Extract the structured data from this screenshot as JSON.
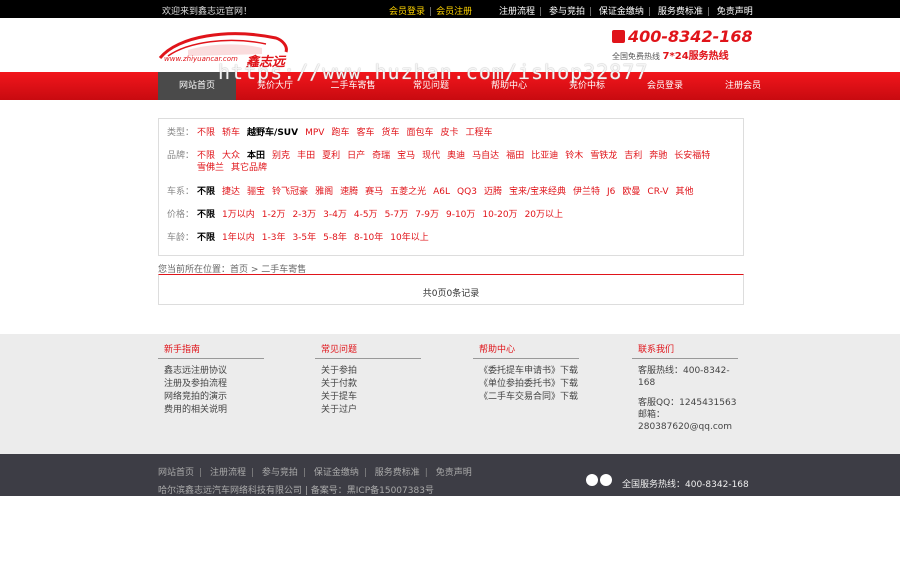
{
  "topbar": {
    "welcome": "欢迎来到鑫志远官网！",
    "member_login": "会员登录",
    "member_register": "会员注册",
    "links": [
      "注册流程",
      "参与竞拍",
      "保证金缴纳",
      "服务费标准",
      "免责声明"
    ]
  },
  "header": {
    "logo_text": "鑫志远",
    "logo_url": "www.zhiyuancar.com",
    "phone": "400-8342-168",
    "hotline_label": "全国免费热线",
    "hotline_hours": "7*24服务热线"
  },
  "watermark": "https://www.huzhan.com/ishop32877",
  "nav": [
    "网站首页",
    "竞价大厅",
    "二手车寄售",
    "常见问题",
    "帮助中心",
    "竞价中标",
    "会员登录",
    "注册会员"
  ],
  "filters": [
    {
      "label": "类型：",
      "options": [
        "不限",
        "轿车",
        "越野车/SUV",
        "MPV",
        "跑车",
        "客车",
        "货车",
        "面包车",
        "皮卡",
        "工程车"
      ],
      "selected": 2
    },
    {
      "label": "品牌：",
      "options": [
        "不限",
        "大众",
        "本田",
        "别克",
        "丰田",
        "夏利",
        "日产",
        "奇瑞",
        "宝马",
        "现代",
        "奥迪",
        "马自达",
        "福田",
        "比亚迪",
        "铃木",
        "雪铁龙",
        "吉利",
        "奔驰",
        "长安福特",
        "雪佛兰",
        "其它品牌"
      ],
      "selected": 2
    },
    {
      "label": "车系：",
      "options": [
        "不限",
        "捷达",
        "骊宝",
        "铃飞冠豪",
        "雅阁",
        "速腾",
        "赛马",
        "五菱之光",
        "A6L",
        "QQ3",
        "迈腾",
        "宝来/宝来经典",
        "伊兰特",
        "J6",
        "欧曼",
        "CR-V",
        "其他"
      ],
      "selected": 0
    },
    {
      "label": "价格：",
      "options": [
        "不限",
        "1万以内",
        "1-2万",
        "2-3万",
        "3-4万",
        "4-5万",
        "5-7万",
        "7-9万",
        "9-10万",
        "10-20万",
        "20万以上"
      ],
      "selected": 0
    },
    {
      "label": "车龄：",
      "options": [
        "不限",
        "1年以内",
        "1-3年",
        "3-5年",
        "5-8年",
        "8-10年",
        "10年以上"
      ],
      "selected": 0
    }
  ],
  "breadcrumb": "您当前所在位置：首页 > 二手车寄售",
  "result_text": "共0页0条记录",
  "footer_help": [
    {
      "title": "新手指南",
      "items": [
        "鑫志远注册协议",
        "注册及参拍流程",
        "网络竞拍的演示",
        "费用的相关说明"
      ]
    },
    {
      "title": "常见问题",
      "items": [
        "关于参拍",
        "关于付款",
        "关于提车",
        "关于过户"
      ]
    },
    {
      "title": "帮助中心",
      "items": [
        "《委托提车申请书》下载",
        "《单位参拍委托书》下载",
        "《二手车交易合同》下载"
      ]
    },
    {
      "title": "联系我们",
      "items": [
        "客服热线：400-8342-168",
        "客服QQ：1245431563",
        "邮箱：280387620@qq.com"
      ]
    }
  ],
  "footer_links": [
    "网站首页",
    "注册流程",
    "参与竞拍",
    "保证金缴纳",
    "服务费标准",
    "免责声明"
  ],
  "copyright": "哈尔滨鑫志远汽车网络科技有限公司 | 备案号：黑ICP备15007383号",
  "footer_hotline": "全国服务热线：400-8342-168",
  "colors": {
    "brand_red": "#e0141a",
    "nav_active": "#4a4a4a",
    "footer_dark": "#3d3d45"
  }
}
